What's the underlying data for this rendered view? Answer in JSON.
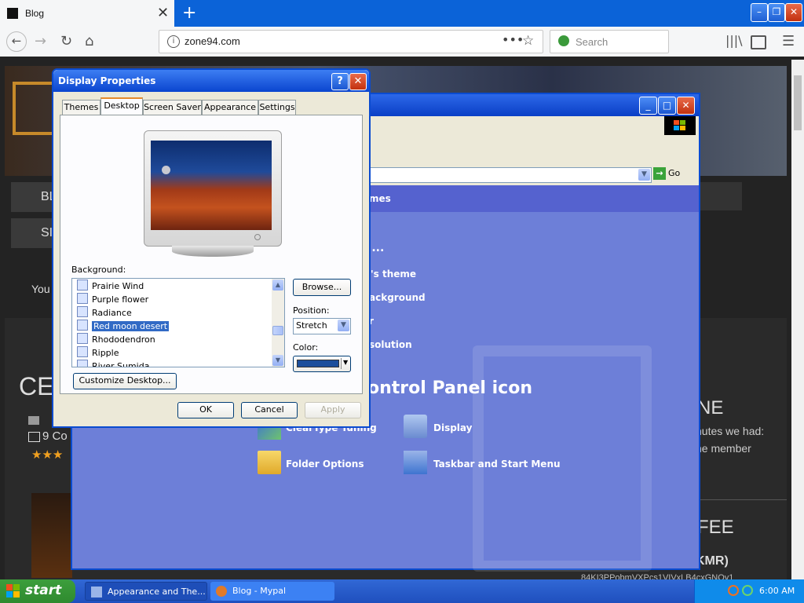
{
  "browser": {
    "tab_title": "Blog",
    "url": "zone94.com",
    "search_placeholder": "Search",
    "newtab_symbol": "+"
  },
  "website": {
    "nav_items": [
      "BL",
      "SI"
    ],
    "text_you": "You",
    "heading_cel": "CEL",
    "meta_comments": "9 Co",
    "heading_ne": "NE",
    "text_right_1": "nutes we had:",
    "text_right_2": "ne member",
    "heading_fee": "FEE",
    "text_kmr": "KMR)",
    "text_hash": "84KI3PPobmVXPcs1VIVxLB4cxGNQy1"
  },
  "control_panel": {
    "address_go": "Go",
    "partial_heading": "mes",
    "partial_dots": "....",
    "tasks": [
      "'s theme",
      "ackground",
      "r",
      "solution"
    ],
    "icon_heading": "ontrol Panel icon",
    "icons": [
      {
        "label": "ClearType Tuning",
        "icon": "cleartype-icon"
      },
      {
        "label": "Display",
        "icon": "display-icon"
      },
      {
        "label": "Folder Options",
        "icon": "folder-options-icon"
      },
      {
        "label": "Taskbar and Start Menu",
        "icon": "taskbar-icon"
      }
    ]
  },
  "dialog": {
    "title": "Display Properties",
    "tabs": [
      "Themes",
      "Desktop",
      "Screen Saver",
      "Appearance",
      "Settings"
    ],
    "selected_tab": "Desktop",
    "background_label": "Background:",
    "backgrounds": [
      "Prairie Wind",
      "Purple flower",
      "Radiance",
      "Red moon desert",
      "Rhododendron",
      "Ripple",
      "River Sumida"
    ],
    "selected_background": "Red moon desert",
    "browse_label": "Browse...",
    "position_label": "Position:",
    "position_value": "Stretch",
    "color_label": "Color:",
    "color_value": "#1c4f9c",
    "customize_label": "Customize Desktop...",
    "ok_label": "OK",
    "cancel_label": "Cancel",
    "apply_label": "Apply"
  },
  "taskbar": {
    "start_label": "start",
    "items": [
      "Appearance and The...",
      "Blog - Mypal"
    ],
    "clock": "6:00 AM"
  }
}
